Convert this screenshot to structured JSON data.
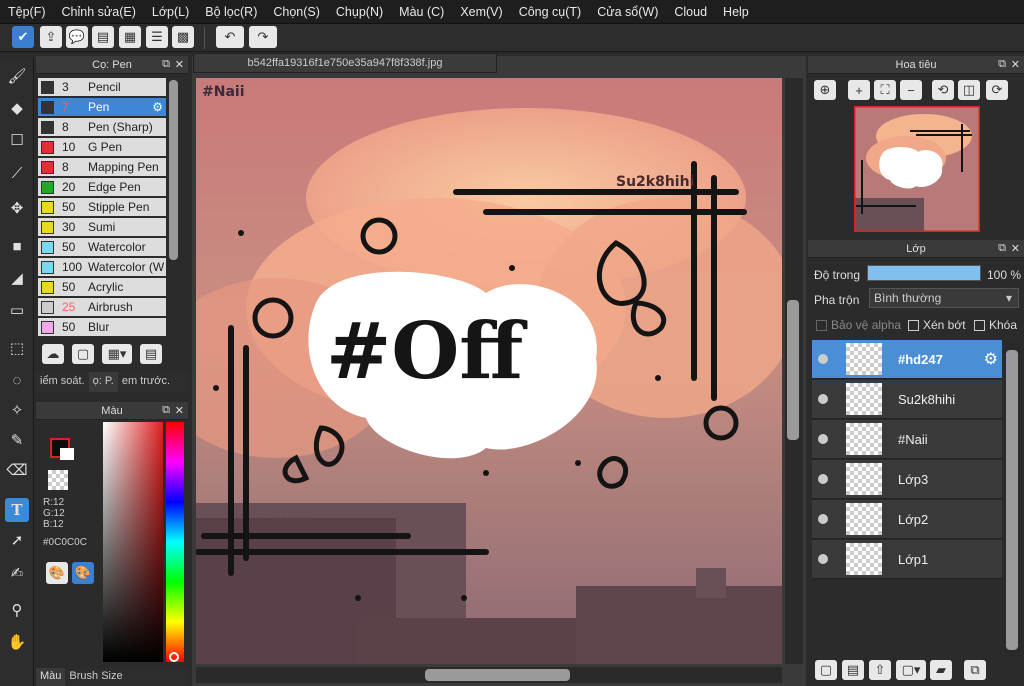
{
  "menu": [
    "Tệp(F)",
    "Chỉnh sửa(E)",
    "Lớp(L)",
    "Bộ lọc(R)",
    "Chọn(S)",
    "Chụp(N)",
    "Màu (C)",
    "Xem(V)",
    "Công cụ(T)",
    "Cửa sổ(W)",
    "Cloud",
    "Help"
  ],
  "canvas": {
    "filename": "b542ffa19316f1e750e35a947f8f338f.jpg",
    "texts": [
      "#Naii",
      "Su2k8hihi",
      "#hd247"
    ],
    "sticker": "#Off"
  },
  "brush_panel": {
    "title": "Cọ: Pen",
    "brushes": [
      {
        "size": "3",
        "name": "Pencil",
        "color": "#333333"
      },
      {
        "size": "7",
        "name": "Pen",
        "color": "#333333"
      },
      {
        "size": "8",
        "name": "Pen (Sharp)",
        "color": "#333333"
      },
      {
        "size": "10",
        "name": "G Pen",
        "color": "#e03030"
      },
      {
        "size": "8",
        "name": "Mapping Pen",
        "color": "#e03030"
      },
      {
        "size": "20",
        "name": "Edge Pen",
        "color": "#22aa22"
      },
      {
        "size": "50",
        "name": "Stipple Pen",
        "color": "#e8d820"
      },
      {
        "size": "30",
        "name": "Sumi",
        "color": "#e8d820"
      },
      {
        "size": "50",
        "name": "Watercolor",
        "color": "#7ad8f0"
      },
      {
        "size": "100",
        "name": "Watercolor (W",
        "color": "#7ad8f0"
      },
      {
        "size": "50",
        "name": "Acrylic",
        "color": "#e8d820"
      },
      {
        "size": "25",
        "name": "Airbrush",
        "color": "#cccccc"
      },
      {
        "size": "50",
        "name": "Blur",
        "color": "#f0a8e8"
      }
    ],
    "tabs": [
      "iểm soát.",
      "ọ: P.",
      "em trước."
    ]
  },
  "color_panel": {
    "title": "Màu",
    "r": "R:12",
    "g": "G:12",
    "b": "B:12",
    "hex": "#0C0C0C",
    "tabs": [
      "Màu",
      "Brush Size"
    ]
  },
  "navigator": {
    "title": "Hoa tiêu"
  },
  "layers": {
    "title": "Lớp",
    "opacity_label": "Độ trong",
    "opacity_value": "100 %",
    "opacity": 1.0,
    "blend_label": "Pha trộn",
    "blend_value": "Bình thường",
    "protect_alpha": "Bảo vệ alpha",
    "clipping": "Xén bớt",
    "lock": "Khóa",
    "items": [
      {
        "name": "#hd247",
        "selected": true
      },
      {
        "name": "Su2k8hihi",
        "selected": false
      },
      {
        "name": "#Naii",
        "selected": false
      },
      {
        "name": "Lớp3",
        "selected": false
      },
      {
        "name": "Lớp2",
        "selected": false
      },
      {
        "name": "Lớp1",
        "selected": false
      }
    ]
  }
}
